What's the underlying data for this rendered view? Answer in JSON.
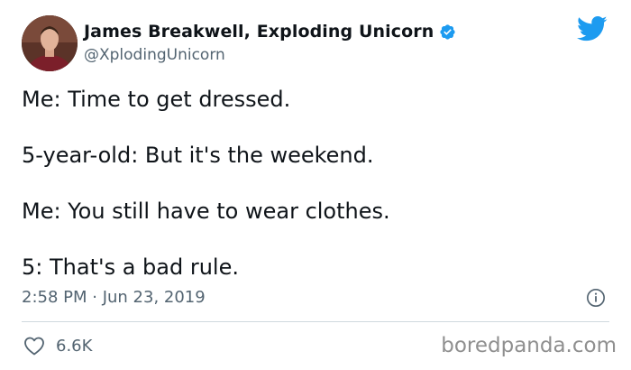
{
  "author": {
    "name": "James Breakwell, Exploding Unicorn",
    "handle": "@XplodingUnicorn",
    "verified": true
  },
  "tweet": {
    "lines": [
      "Me: Time to get dressed.",
      "5-year-old: But it's the weekend.",
      "Me: You still have to wear clothes.",
      "5: That's a bad rule."
    ],
    "timestamp": "2:58 PM · Jun 23, 2019",
    "likes": "6.6K"
  },
  "watermark": "boredpanda.com",
  "icons": {
    "brand": "twitter-bird-icon",
    "verified": "verified-badge-icon",
    "info": "info-icon",
    "like": "heart-icon"
  },
  "colors": {
    "twitter_blue": "#1d9bf0",
    "text": "#0f1419",
    "secondary": "#536471"
  }
}
